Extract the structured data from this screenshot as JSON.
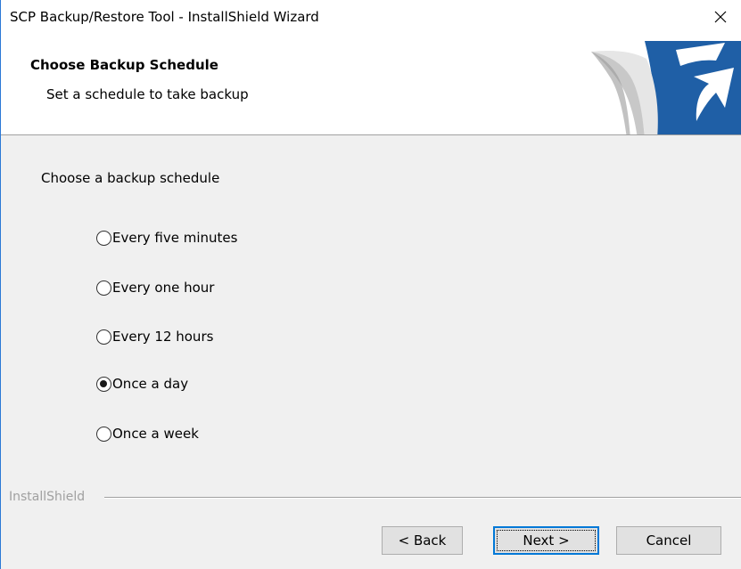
{
  "window": {
    "title": "SCP Backup/Restore Tool - InstallShield Wizard"
  },
  "header": {
    "title": "Choose Backup Schedule",
    "subtitle": "Set a schedule to take backup",
    "logo_icon": "installshield-logo-icon"
  },
  "content": {
    "prompt": "Choose a backup schedule",
    "options": [
      {
        "label": "Every five minutes",
        "checked": false
      },
      {
        "label": "Every one hour",
        "checked": false
      },
      {
        "label": "Every 12 hours",
        "checked": false
      },
      {
        "label": "Once a day",
        "checked": true
      },
      {
        "label": "Once a week",
        "checked": false
      }
    ]
  },
  "footer": {
    "brand": "InstallShield",
    "back_label": "< Back",
    "next_label": "Next >",
    "cancel_label": "Cancel"
  },
  "colors": {
    "accent": "#0078d7",
    "logo_blue": "#1f5fa6",
    "background": "#f0f0f0"
  }
}
